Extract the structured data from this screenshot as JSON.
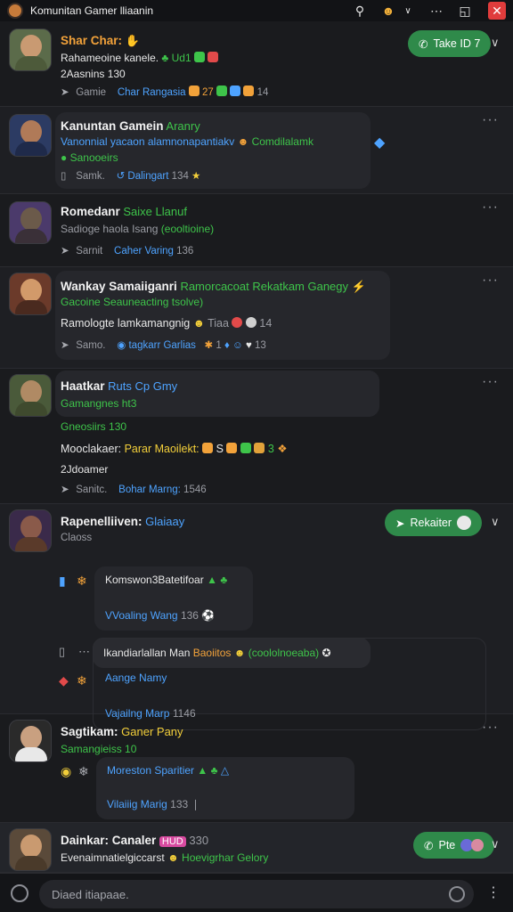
{
  "window": {
    "title": "Komunitan Gamer lliaanin"
  },
  "colors": {
    "accent_green": "#2f8a4a",
    "close_red": "#e03c3c"
  },
  "icons": [
    "app-avatar-icon",
    "search-icon",
    "emoji-icon",
    "chevron-down-icon",
    "more-icon",
    "window-icon",
    "close-icon",
    "phone-icon",
    "ellipsis-icon",
    "attach-icon",
    "send-icon"
  ],
  "posts": [
    {
      "name": "Shar Char:",
      "badge": "Take ID 7",
      "line2": "Rahameoine kanele.",
      "line2b": "Ud1",
      "line3": "2Aasnins 130",
      "meta_author": "Gamie",
      "meta_group": "Char Rangasia",
      "meta_tail": "27",
      "meta_count": "14"
    },
    {
      "name": "Kanuntan Gamein",
      "name_tag": "Aranry",
      "line2": "Vanonnial yacaon alamnonapantiakv",
      "line2b": "Comdilalamk",
      "line3": "Sanooeirs",
      "meta_author": "Samk.",
      "meta_group": "Dalingart",
      "meta_count": "134"
    },
    {
      "name": "Romedanr",
      "name_tag": "Saixe Llanuf",
      "line2": "Sadioge haola Isang",
      "line2b": "(eooltioine)",
      "meta_author": "Sarnit",
      "meta_group": "Caher Varing",
      "meta_count": "136"
    },
    {
      "name": "Wankay Samaiiganri",
      "name_tag": "Ramorcacoat Rekatkam Ganegy",
      "line2": "Gacoine Seauneacting tsolve)",
      "line3": "Ramologte lamkamangnig",
      "line3b": "Tiaa",
      "line3c": "14",
      "meta_author": "Samo.",
      "meta_group": "tagkarr Garlias",
      "meta_count": "1",
      "meta_tail": "13"
    },
    {
      "name": "Haatkar",
      "name_tag": "Ruts Cp Gmy",
      "line2": "Gamangnes ht3",
      "line3": "Gneosiirs 130",
      "line4": "Mooclakaer:",
      "line4b": "Parar Maoilekt:",
      "line4c": "S",
      "line4d": "3",
      "line5": "2Jdoamer",
      "meta_author": "Sanitc.",
      "meta_group": "Bohar Marng:",
      "meta_count": "1546"
    },
    {
      "name": "Rapenelliiven:",
      "name_tag": "Glaiaay",
      "badge": "Rekaiter",
      "line2": "Claoss",
      "reply1_a": "Komswon3Batetifoar",
      "reply1_b": "VVoaling Wang",
      "reply1_c": "136",
      "reply2_a": "Ikandiarlallan Man",
      "reply2_b": "Baoiitos",
      "reply2_c": "(coololnoeaba)",
      "reply2_d": "Aange Namy",
      "reply2_e": "Vajailng Marp",
      "reply2_f": "1146"
    },
    {
      "name": "Sagtikam:",
      "name_tag": "Ganer Pany",
      "line2": "Samangieiss 10",
      "reply_a": "Moreston Sparitier",
      "reply_b": "Vilaiiig Marig",
      "reply_c": "133"
    },
    {
      "name": "Dainkar: Canaler",
      "name_tag": "HUD",
      "name_count": "330",
      "line2": "Evenaimnatielgiccarst",
      "line2b": "Hoevigrhar Gelory",
      "badge": "Pte"
    }
  ],
  "input": {
    "placeholder": "Diaed itiapaae."
  }
}
